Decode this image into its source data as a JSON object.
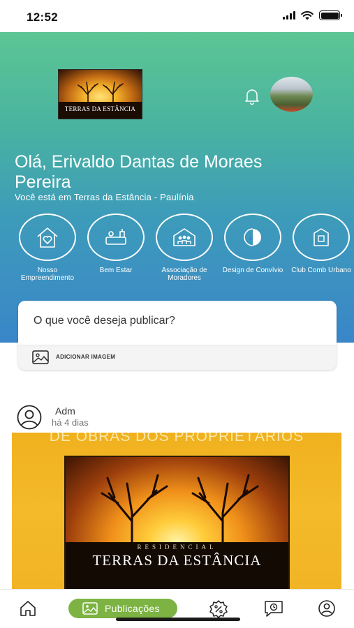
{
  "status_bar": {
    "time": "12:52"
  },
  "header": {
    "logo": {
      "subtitle": "RESIDENCIAL",
      "name": "TERRAS DA ESTÂNCIA"
    }
  },
  "greeting": "Olá, Erivaldo Dantas de Moraes Pereira",
  "location": "Você está em Terras da Estância - Paulínia",
  "categories": [
    {
      "label": "Nosso Empreendimento",
      "icon": "house-heart-icon"
    },
    {
      "label": "Bem Estar",
      "icon": "spa-icon"
    },
    {
      "label": "Associação de Moradores",
      "icon": "community-icon"
    },
    {
      "label": "Design de Convívio",
      "icon": "design-icon"
    },
    {
      "label": "Club Comb Urbano",
      "icon": "building-icon"
    }
  ],
  "publish": {
    "prompt": "O que você deseja publicar?",
    "add_image": "ADICIONAR IMAGEM"
  },
  "post": {
    "author": "Adm",
    "time": "há 4 dias",
    "banner_text": "DE OBRAS DOS PROPRIETÁRIOS",
    "photo_subtitle": "RESIDENCIAL",
    "photo_title": "TERRAS DA ESTÂNCIA"
  },
  "bottom_nav": {
    "active_label": "Publicações",
    "accent_color": "#7cb342"
  }
}
